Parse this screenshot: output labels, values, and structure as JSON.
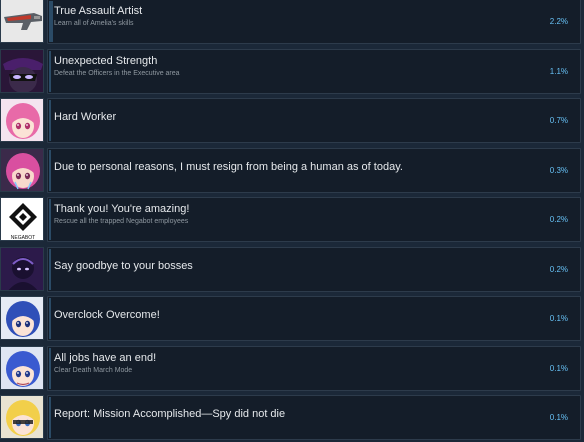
{
  "achievements": [
    {
      "title": "True Assault Artist",
      "description": "Learn all of Amelia's skills",
      "percent_label": "2.2%",
      "percent": 2.2,
      "icon": "gun-icon"
    },
    {
      "title": "Unexpected Strength",
      "description": "Defeat the Officers in the Executive area",
      "percent_label": "1.1%",
      "percent": 1.1,
      "icon": "masked-officer-icon"
    },
    {
      "title": "Hard Worker",
      "description": "",
      "percent_label": "0.7%",
      "percent": 0.7,
      "icon": "pink-hair-girl-icon"
    },
    {
      "title": "Due to personal reasons, I must resign from being a human as of today.",
      "description": "",
      "percent_label": "0.3%",
      "percent": 0.3,
      "icon": "crying-girl-icon"
    },
    {
      "title": "Thank you! You're amazing!",
      "description": "Rescue all the trapped Negabot employees",
      "percent_label": "0.2%",
      "percent": 0.2,
      "icon": "negabot-logo-icon",
      "icon_text": "NEGABOT"
    },
    {
      "title": "Say goodbye to your bosses",
      "description": "",
      "percent_label": "0.2%",
      "percent": 0.2,
      "icon": "boss-silhouette-icon"
    },
    {
      "title": "Overclock Overcome!",
      "description": "",
      "percent_label": "0.1%",
      "percent": 0.1,
      "icon": "blue-hair-girl-icon"
    },
    {
      "title": "All jobs have an end!",
      "description": "Clear Death March Mode",
      "percent_label": "0.1%",
      "percent": 0.1,
      "icon": "blue-hair-girl-2-icon"
    },
    {
      "title": "Report: Mission Accomplished—Spy did not die",
      "description": "",
      "percent_label": "0.1%",
      "percent": 0.1,
      "icon": "blonde-spy-icon"
    }
  ],
  "colors": {
    "background": "#1b2838",
    "panel": "#141d29",
    "progress": "#2b4b66",
    "percent_text": "#67c1f5",
    "title_text": "#e6e9ec",
    "description_text": "#8f98a0"
  }
}
